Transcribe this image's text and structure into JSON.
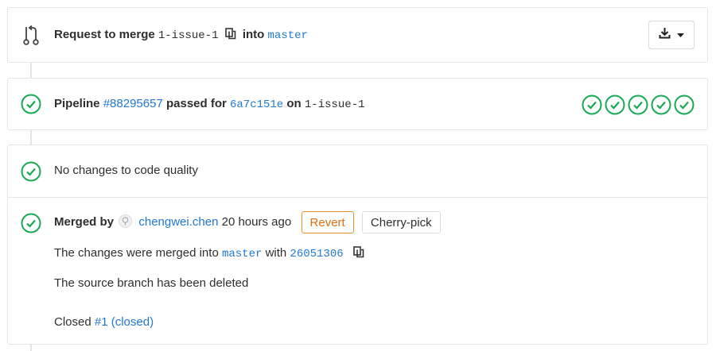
{
  "merge_request": {
    "prefix": "Request to merge",
    "source_branch": "1-issue-1",
    "into": "into",
    "target_branch": "master"
  },
  "pipeline": {
    "label": "Pipeline",
    "id": "#88295657",
    "passed_for": "passed for",
    "commit": "6a7c151e",
    "on": "on",
    "branch": "1-issue-1",
    "stage_count": 5
  },
  "code_quality": {
    "text": "No changes to code quality"
  },
  "merged": {
    "merged_by": "Merged by",
    "user": "chengwei.chen",
    "time": "20 hours ago",
    "revert_label": "Revert",
    "cherry_pick_label": "Cherry-pick",
    "merged_into_prefix": "The changes were merged into",
    "merged_into_branch": "master",
    "with": "with",
    "merge_commit": "26051306",
    "source_deleted": "The source branch has been deleted",
    "closed_prefix": "Closed",
    "closed_issue": "#1 (closed)"
  },
  "colors": {
    "success": "#1aaa55",
    "link": "#1f78d1",
    "warning": "#e07010",
    "border": "#e5e5e5"
  },
  "icons": {
    "merge_request": "merge-request-icon",
    "copy": "copy-icon",
    "download": "download-icon",
    "caret": "chevron-down-icon",
    "status_success": "status-success-icon",
    "stage_success": "stage-success-icon",
    "avatar": "avatar"
  }
}
